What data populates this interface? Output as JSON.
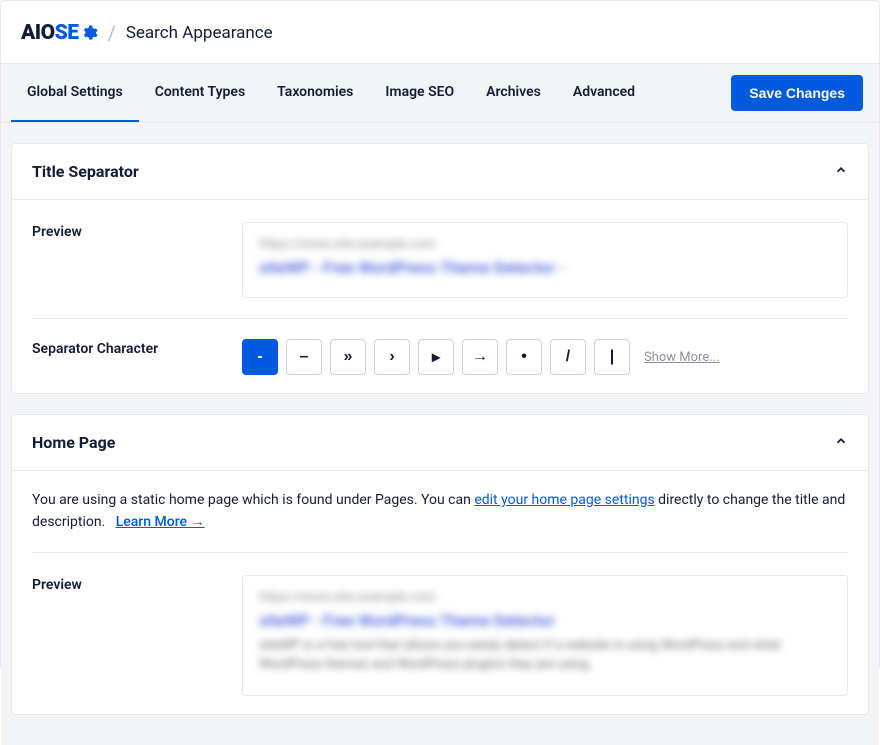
{
  "brand": {
    "logo_aio": "AIO",
    "logo_seo": "SE"
  },
  "header": {
    "slash": "/",
    "page_title": "Search Appearance"
  },
  "tabs": [
    {
      "label": "Global Settings",
      "active": true
    },
    {
      "label": "Content Types",
      "active": false
    },
    {
      "label": "Taxonomies",
      "active": false
    },
    {
      "label": "Image SEO",
      "active": false
    },
    {
      "label": "Archives",
      "active": false
    },
    {
      "label": "Advanced",
      "active": false
    }
  ],
  "save_button": "Save Changes",
  "cards": {
    "title_separator": {
      "title": "Title Separator",
      "preview_label": "Preview",
      "preview_url": "https://www.site.example.com",
      "preview_title": "siteWP - Free WordPress Theme Detector -",
      "separator_label": "Separator Character",
      "separators": [
        "-",
        "–",
        "»",
        "›",
        "▸",
        "→",
        "•",
        "/",
        "|"
      ],
      "active_separator": 0,
      "show_more": "Show More..."
    },
    "home_page": {
      "title": "Home Page",
      "notice_pre": "You are using a static home page which is found under Pages. You can ",
      "notice_link": "edit your home page settings",
      "notice_post": " directly to change the title and description.",
      "learn_more": "Learn More",
      "preview_label": "Preview",
      "preview_url": "https://www.site.example.com",
      "preview_title": "siteWP - Free WordPress Theme Detector",
      "preview_desc": "siteWP is a free tool that allows you easily detect if a website is using WordPress and what WordPress themes and WordPress plugins they are using."
    }
  }
}
